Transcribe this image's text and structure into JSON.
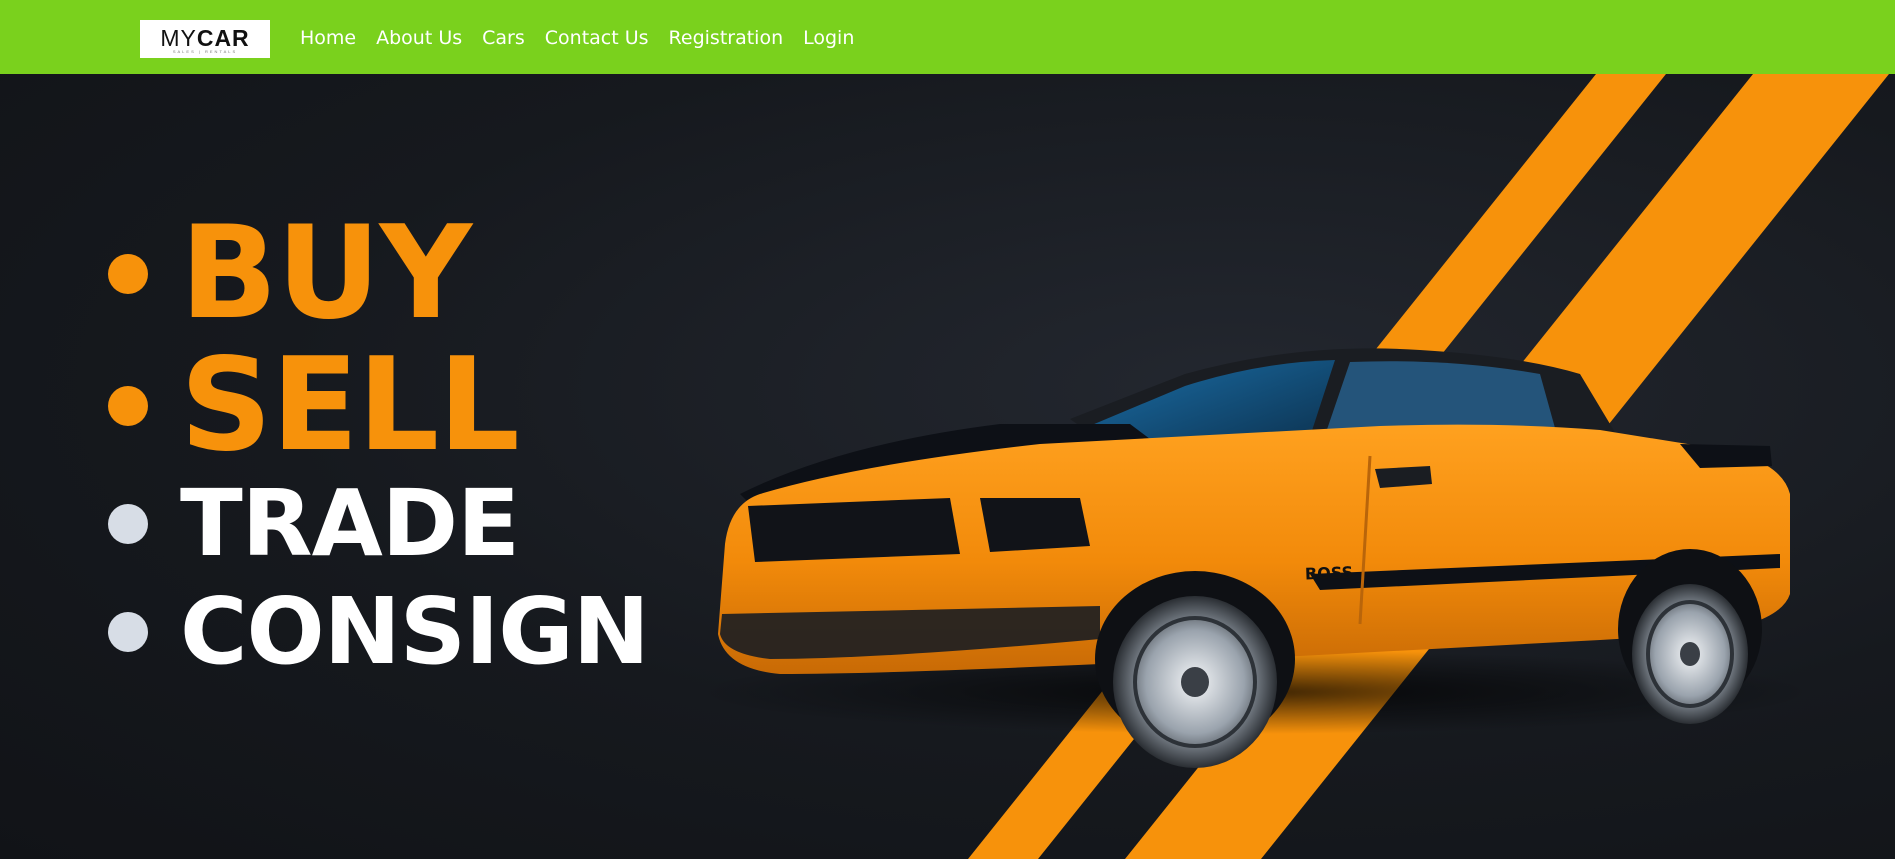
{
  "header": {
    "logo": {
      "text_my": "MY",
      "text_car": "CAR",
      "tagline": "SALES  |  RENTALS",
      "icon": "mycar-logo"
    },
    "nav": [
      {
        "label": "Home"
      },
      {
        "label": "About Us"
      },
      {
        "label": "Cars"
      },
      {
        "label": "Contact Us"
      },
      {
        "label": "Registration"
      },
      {
        "label": "Login"
      }
    ]
  },
  "hero": {
    "words": [
      {
        "text": "BUY",
        "color": "#f7920b"
      },
      {
        "text": "SELL",
        "color": "#f7920b"
      },
      {
        "text": "TRADE",
        "color": "#ffffff"
      },
      {
        "text": "CONSIGN",
        "color": "#ffffff"
      }
    ],
    "bullet_colors": [
      "#f7920b",
      "#f7920b",
      "#d7dde6",
      "#d7dde6"
    ],
    "car_badge": "BOSS",
    "image": "orange-mustang-car"
  },
  "colors": {
    "navbar": "#7ad11d",
    "accent": "#f7920b",
    "background": "#15181d"
  }
}
